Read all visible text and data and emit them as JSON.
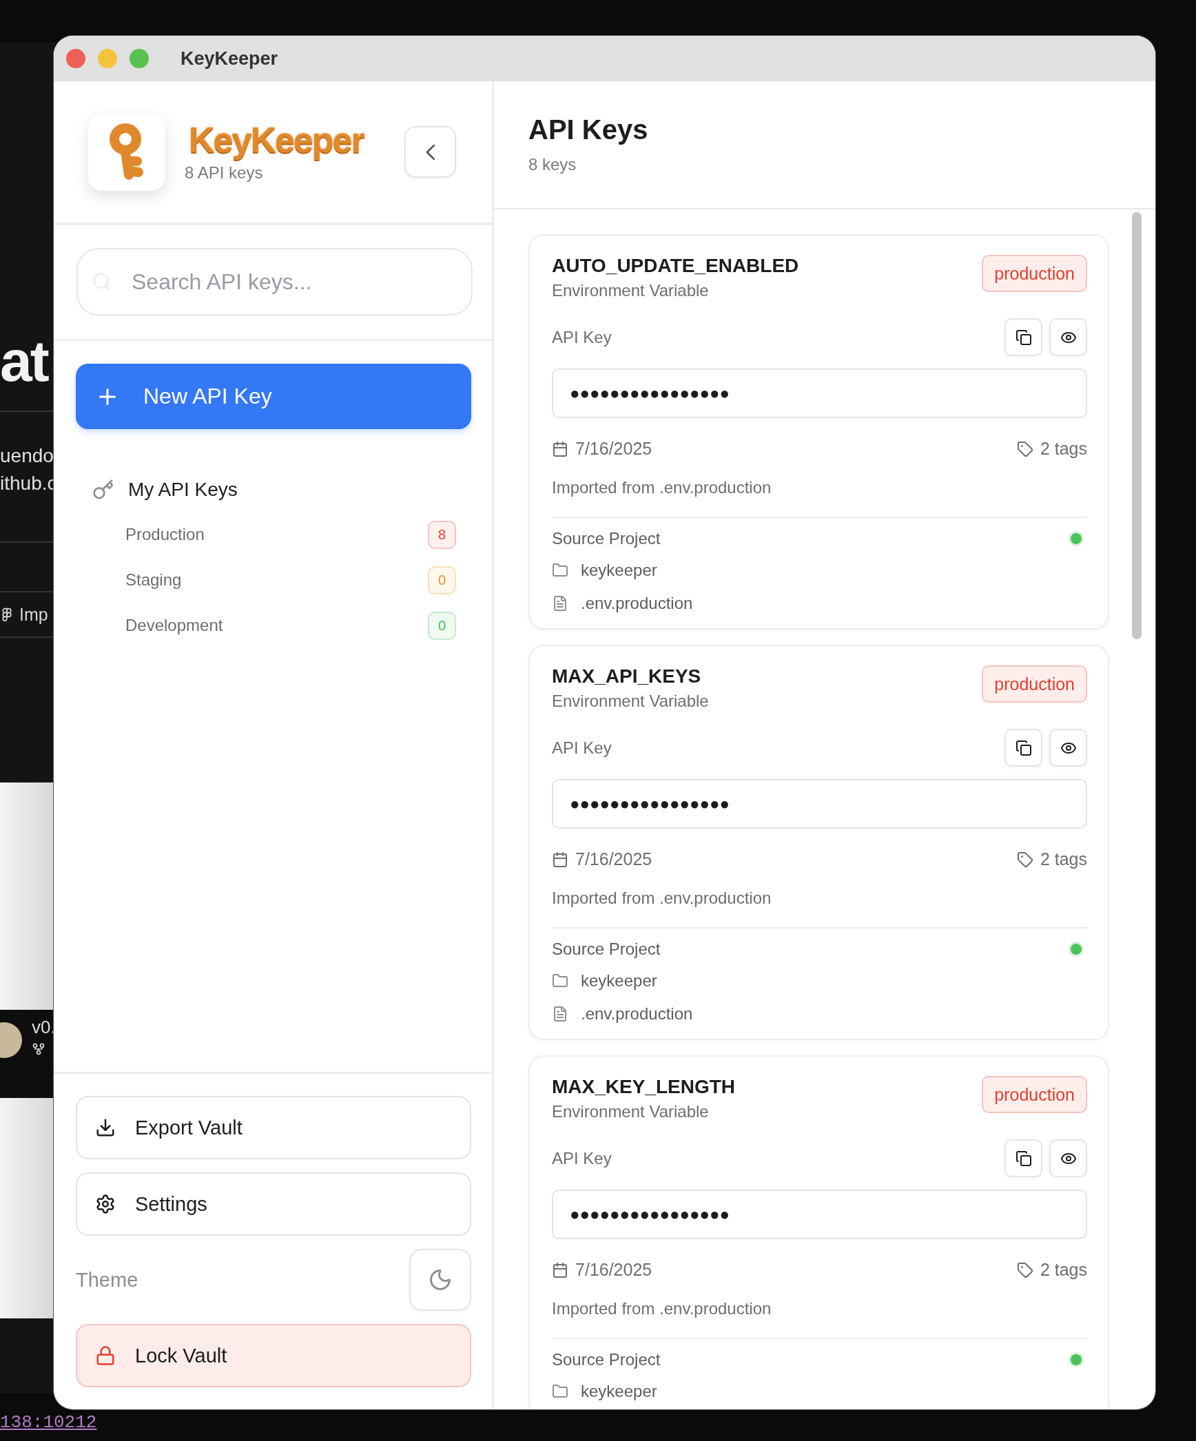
{
  "background_window": {
    "heading": "at",
    "lines": [
      "uendo",
      "ithub.c"
    ],
    "menu_item": "Imp",
    "version": "v0.",
    "code": "138:10212"
  },
  "window": {
    "title": "KeyKeeper"
  },
  "sidebar": {
    "app_name": "KeyKeeper",
    "key_count": "8 API keys",
    "search": {
      "placeholder": "Search API keys..."
    },
    "new_button": "New API Key",
    "section": {
      "label": "My API Keys",
      "items": [
        {
          "label": "Production",
          "count": "8",
          "color": "#e5402f"
        },
        {
          "label": "Staging",
          "count": "0",
          "color": "#f0961a"
        },
        {
          "label": "Development",
          "count": "0",
          "color": "#45c052"
        }
      ]
    },
    "actions": [
      {
        "kind": "export",
        "label": "Export Vault"
      },
      {
        "kind": "settings",
        "label": "Settings"
      }
    ],
    "theme": {
      "label": "Theme"
    },
    "lock_button": "Lock Vault"
  },
  "main": {
    "title": "API Keys",
    "subtitle": "8 keys",
    "cards": [
      {
        "name": "AUTO_UPDATE_ENABLED",
        "type": "Environment Variable",
        "env": {
          "label": "production",
          "color": "#e5402f"
        },
        "key_label": "API Key",
        "masked_value": "●●●●●●●●●●●●●●●●",
        "date": "7/16/2025",
        "tags": "2 tags",
        "note": "Imported from .env.production",
        "source_label": "Source Project",
        "source_active": true,
        "project": "keykeeper",
        "file": ".env.production"
      },
      {
        "name": "MAX_API_KEYS",
        "type": "Environment Variable",
        "env": {
          "label": "production",
          "color": "#e5402f"
        },
        "key_label": "API Key",
        "masked_value": "●●●●●●●●●●●●●●●●",
        "date": "7/16/2025",
        "tags": "2 tags",
        "note": "Imported from .env.production",
        "source_label": "Source Project",
        "source_active": true,
        "project": "keykeeper",
        "file": ".env.production"
      },
      {
        "name": "MAX_KEY_LENGTH",
        "type": "Environment Variable",
        "env": {
          "label": "production",
          "color": "#e5402f"
        },
        "key_label": "API Key",
        "masked_value": "●●●●●●●●●●●●●●●●",
        "date": "7/16/2025",
        "tags": "2 tags",
        "note": "Imported from .env.production",
        "source_label": "Source Project",
        "source_active": true,
        "project": "keykeeper"
      }
    ]
  }
}
